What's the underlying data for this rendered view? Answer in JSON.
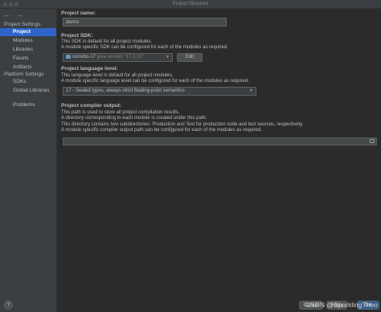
{
  "window": {
    "title": "Project Structure"
  },
  "sidebar": {
    "sections": [
      {
        "title": "Project Settings",
        "items": [
          {
            "label": "Project",
            "selected": true
          },
          {
            "label": "Modules"
          },
          {
            "label": "Libraries"
          },
          {
            "label": "Facets"
          },
          {
            "label": "Artifacts"
          }
        ]
      },
      {
        "title": "Platform Settings",
        "items": [
          {
            "label": "SDKs"
          },
          {
            "label": "Global Libraries"
          }
        ]
      }
    ],
    "problems_label": "Problems",
    "help_label": "?"
  },
  "project_name": {
    "label": "Project name:",
    "value": "demo"
  },
  "sdk": {
    "label": "Project SDK:",
    "desc1": "This SDK is default for all project modules.",
    "desc2": "A module specific SDK can be configured for each of the modules as required.",
    "selected_name": "corretto-17",
    "selected_version": "java version \"17.0.13\"",
    "edit_label": "Edit"
  },
  "language_level": {
    "label": "Project language level:",
    "desc1": "This language level is default for all project modules.",
    "desc2": "A module specific language level can be configured for each of the modules as required.",
    "selected": "17 - Sealed types, always-strict floating-point semantics"
  },
  "compiler_output": {
    "label": "Project compiler output:",
    "desc1": "This path is used to store all project compilation results.",
    "desc2": "A directory corresponding to each module is created under this path.",
    "desc3": "This directory contains two subdirectories: Production and Test for production code and test sources, respectively.",
    "desc4": "A module specific compiler output path can be configured for each of the modules as required.",
    "value": ""
  },
  "footer": {
    "cancel_label": "Cancel",
    "apply_label": "Apply",
    "ok_label": "OK"
  },
  "watermark": "CSDN @SparklingTheo"
}
